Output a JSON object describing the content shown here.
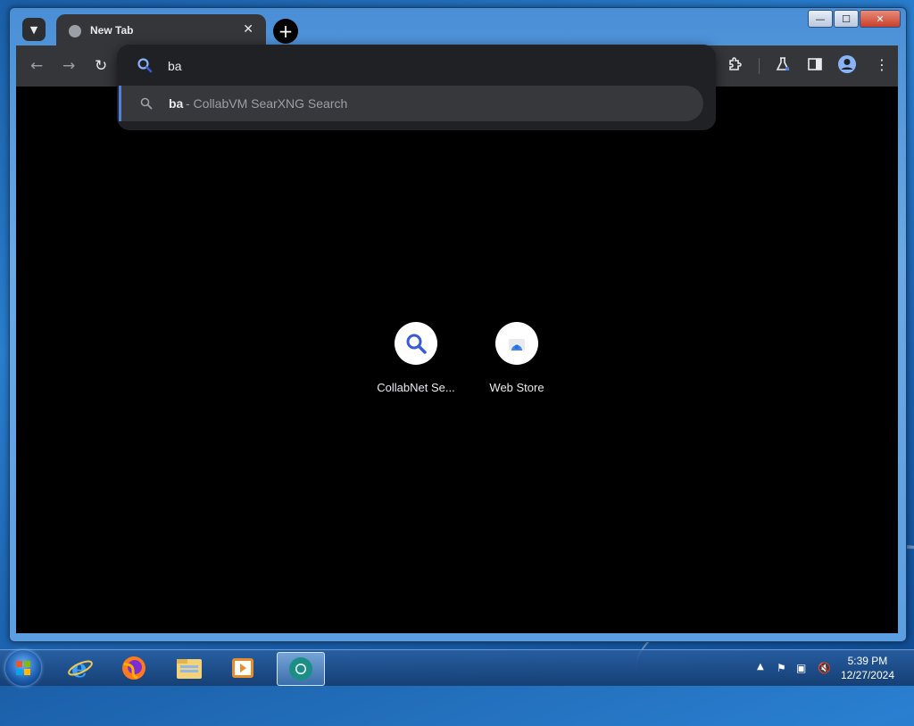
{
  "browser": {
    "tab": {
      "title": "New Tab",
      "close": "✕"
    },
    "new_tab_symbol": "+",
    "omnibox": {
      "typed_text": "ba",
      "suggestion": {
        "query": "ba",
        "description": "- CollabVM SearXNG Search"
      }
    }
  },
  "shortcuts": [
    {
      "label": "CollabNet Se...",
      "icon": "magnifier-icon"
    },
    {
      "label": "Web Store",
      "icon": "web-store-icon"
    }
  ],
  "taskbar": {
    "apps": [
      "internet-explorer-icon",
      "firefox-icon",
      "file-explorer-icon",
      "media-player-icon",
      "chrome-browser-icon"
    ],
    "clock": {
      "time": "5:39 PM",
      "date": "12/27/2024"
    }
  },
  "colors": {
    "accent": "#4a80e8",
    "toolbar": "#35363a",
    "omnibox": "#202124",
    "content": "#000000"
  }
}
